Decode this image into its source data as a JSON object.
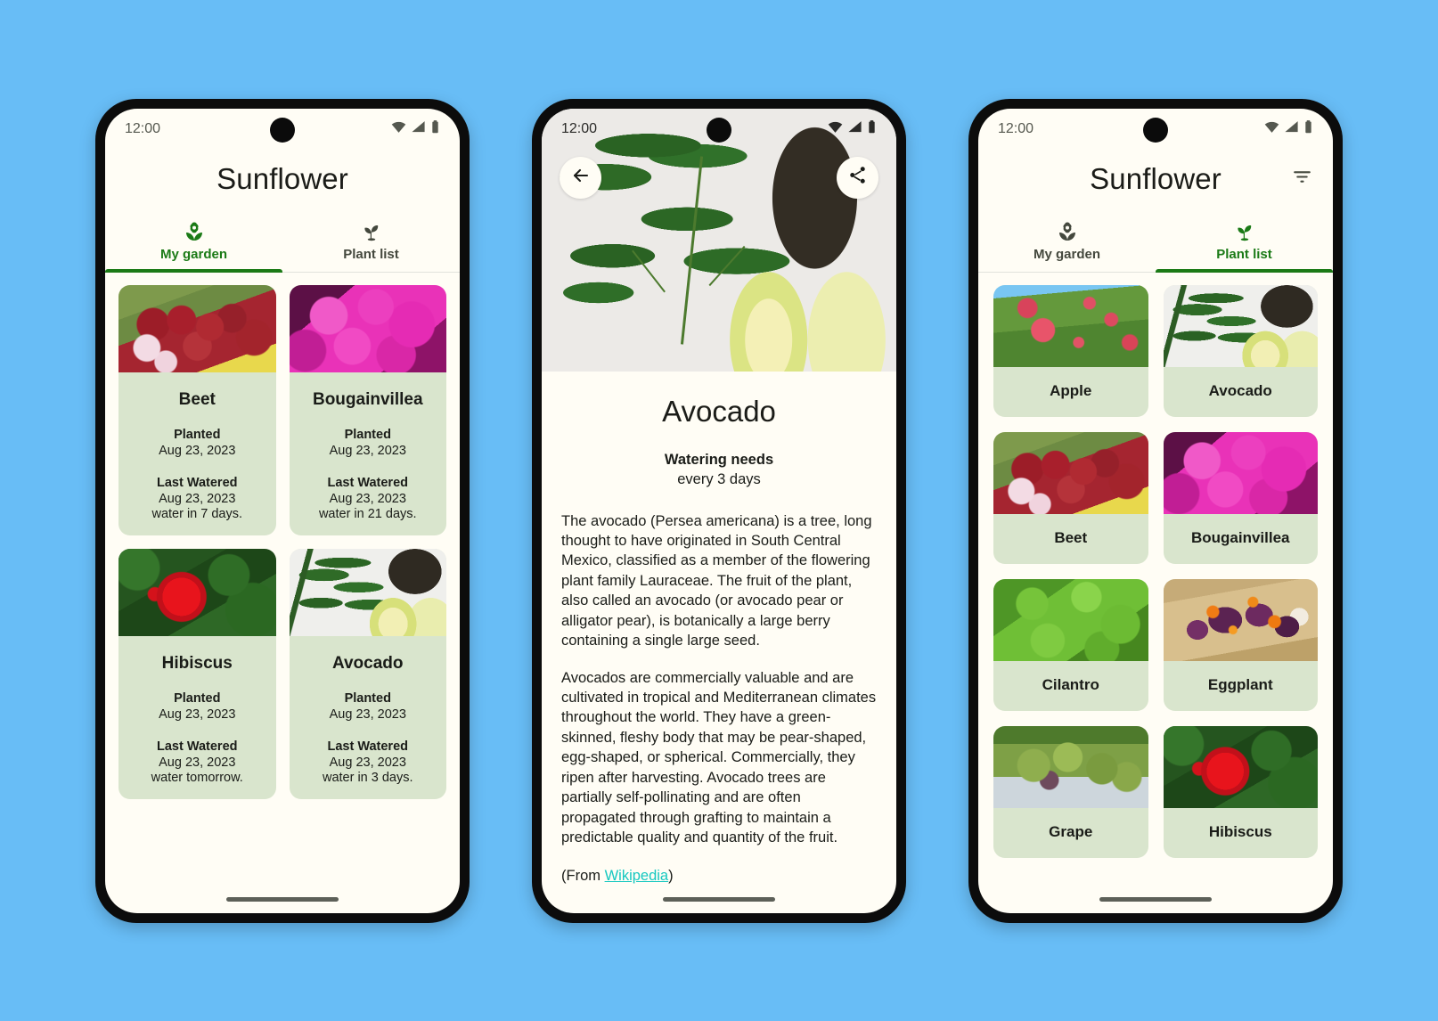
{
  "theme": {
    "outer_background": "#68bdf6",
    "screen_background": "#fffdf5",
    "card_background": "#d9e5cd",
    "accent_green": "#1b7a16",
    "link_color": "#16c8c0"
  },
  "status_bar": {
    "time": "12:00",
    "icons": [
      "wifi-icon",
      "signal-icon",
      "battery-icon"
    ]
  },
  "phone1": {
    "app_title": "Sunflower",
    "tabs": [
      {
        "label": "My garden",
        "icon": "flower-icon",
        "active": true
      },
      {
        "label": "Plant list",
        "icon": "sprout-icon",
        "active": false
      }
    ],
    "garden": [
      {
        "name": "Beet",
        "planted_label": "Planted",
        "planted_date": "Aug 23, 2023",
        "watered_label": "Last Watered",
        "watered_date": "Aug 23, 2023",
        "next_water": "water in 7 days.",
        "image": "beet-image"
      },
      {
        "name": "Bougainvillea",
        "planted_label": "Planted",
        "planted_date": "Aug 23, 2023",
        "watered_label": "Last Watered",
        "watered_date": "Aug 23, 2023",
        "next_water": "water in 21 days.",
        "image": "bougainvillea-image"
      },
      {
        "name": "Hibiscus",
        "planted_label": "Planted",
        "planted_date": "Aug 23, 2023",
        "watered_label": "Last Watered",
        "watered_date": "Aug 23, 2023",
        "next_water": "water tomorrow.",
        "image": "hibiscus-image"
      },
      {
        "name": "Avocado",
        "planted_label": "Planted",
        "planted_date": "Aug 23, 2023",
        "watered_label": "Last Watered",
        "watered_date": "Aug 23, 2023",
        "next_water": "water in 3 days.",
        "image": "avocado-image"
      }
    ]
  },
  "phone2": {
    "back_icon": "back-arrow-icon",
    "share_icon": "share-icon",
    "hero_image": "avocado-hero-image",
    "title": "Avocado",
    "watering_label": "Watering needs",
    "watering_value": "every 3 days",
    "paragraph1": "The avocado (Persea americana) is a tree, long thought to have originated in South Central Mexico, classified as a member of the flowering plant family Lauraceae. The fruit of the plant, also called an avocado (or avocado pear or alligator pear), is botanically a large berry containing a single large seed.",
    "paragraph2": "Avocados are commercially valuable and are cultivated in tropical and Mediterranean climates throughout the world. They have a green-skinned, fleshy body that may be pear-shaped, egg-shaped, or spherical. Commercially, they ripen after harvesting. Avocado trees are partially self-pollinating and are often propagated through grafting to maintain a predictable quality and quantity of the fruit.",
    "source_prefix": "(From ",
    "source_link": "Wikipedia",
    "source_suffix": ")"
  },
  "phone3": {
    "app_title": "Sunflower",
    "filter_icon": "filter-list-icon",
    "tabs": [
      {
        "label": "My garden",
        "icon": "flower-icon",
        "active": false
      },
      {
        "label": "Plant list",
        "icon": "sprout-icon",
        "active": true
      }
    ],
    "plants": [
      {
        "name": "Apple",
        "image": "apple-image"
      },
      {
        "name": "Avocado",
        "image": "avocado-image"
      },
      {
        "name": "Beet",
        "image": "beet-image"
      },
      {
        "name": "Bougainvillea",
        "image": "bougainvillea-image"
      },
      {
        "name": "Cilantro",
        "image": "cilantro-image"
      },
      {
        "name": "Eggplant",
        "image": "eggplant-image"
      },
      {
        "name": "Grape",
        "image": "grape-image"
      },
      {
        "name": "Hibiscus",
        "image": "hibiscus-image"
      }
    ]
  }
}
